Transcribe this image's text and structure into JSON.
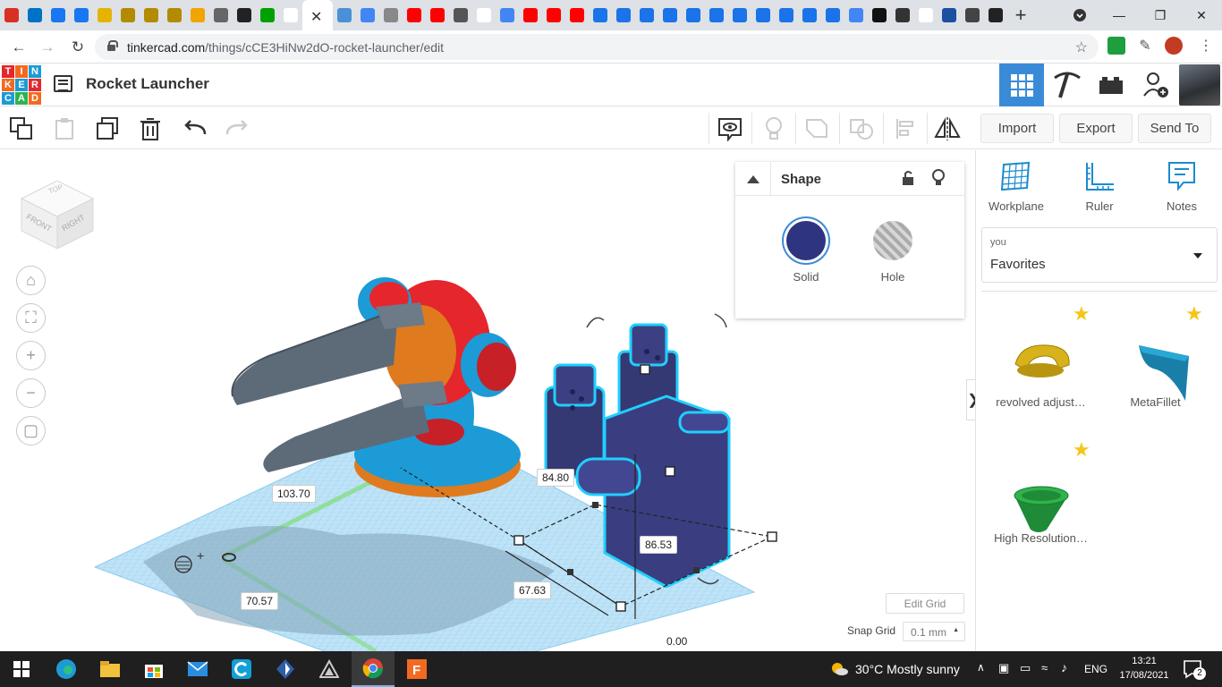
{
  "browser": {
    "url_host": "tinkercad.com",
    "url_path": "/things/cCE3HiNw2dO-rocket-launcher/edit",
    "favicons": [
      "#d93025",
      "#0072c6",
      "#1877f2",
      "#1877f2",
      "#e4b400",
      "#b38b00",
      "#b38b00",
      "#b38b00",
      "#f0a500",
      "#666",
      "#222",
      "#00a000",
      "#fff",
      "#4a90d9",
      "#4285f4",
      "#888",
      "#ff0000",
      "#ff0000",
      "#555",
      "#fff",
      "#4285f4",
      "#ff0000",
      "#ff0000",
      "#ff0000",
      "#1a73e8",
      "#1a73e8",
      "#1a73e8",
      "#1a73e8",
      "#1a73e8",
      "#1a73e8",
      "#1a73e8",
      "#1a73e8",
      "#1a73e8",
      "#1a73e8",
      "#1a73e8",
      "#4285f4",
      "#111",
      "#333",
      "#fff",
      "#1b4fa0",
      "#444",
      "#222"
    ]
  },
  "app": {
    "logo_letters": [
      "TIN",
      "KER",
      "CAD"
    ],
    "project_title": "Rocket Launcher"
  },
  "toolbar": {
    "import_label": "Import",
    "export_label": "Export",
    "send_to_label": "Send To"
  },
  "viewcube": {
    "top": "TOP",
    "front": "FRONT",
    "right": "RIGHT"
  },
  "inspector": {
    "title": "Shape",
    "solid_label": "Solid",
    "hole_label": "Hole",
    "solid_color": "#2f3480"
  },
  "sidebar": {
    "tools": [
      {
        "label": "Workplane"
      },
      {
        "label": "Ruler"
      },
      {
        "label": "Notes"
      }
    ],
    "owner": "you",
    "collection": "Favorites",
    "shapes": [
      {
        "label": "revolved adjust…"
      },
      {
        "label": "MetaFillet"
      },
      {
        "label": "High Resolution…"
      }
    ]
  },
  "dimensions": {
    "width": "103.70",
    "depth": "70.57",
    "sel_height": "84.80",
    "sel_z": "86.53",
    "sel_len": "67.63",
    "elevation": "0.00"
  },
  "grid": {
    "edit_label": "Edit Grid",
    "snap_label": "Snap Grid",
    "snap_value": "0.1 mm"
  },
  "taskbar": {
    "weather": "30°C  Mostly sunny",
    "lang": "ENG",
    "time": "13:21",
    "date": "17/08/2021",
    "notif_count": "2"
  }
}
